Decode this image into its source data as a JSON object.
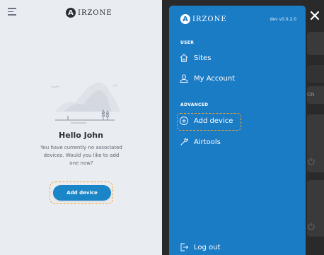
{
  "left": {
    "brand_mark": "A",
    "brand_word": "IRZONE",
    "greeting": "Hello John",
    "message": "You have currently no associated devices. Would you like to add one now?",
    "add_button": "Add device"
  },
  "drawer": {
    "brand_mark": "A",
    "brand_word": "IRZONE",
    "version": "dev v0.0.2.0",
    "sections": {
      "user": "USER",
      "advanced": "ADVANCED"
    },
    "items": {
      "sites": "Sites",
      "my_account": "My Account",
      "add_device": "Add device",
      "airtools": "Airtools",
      "logout": "Log out"
    }
  },
  "background": {
    "partial_label": "ON"
  },
  "colors": {
    "brand_blue": "#1b7cc6",
    "highlight_dashed": "#f0a42c",
    "left_background": "#e9edf2"
  },
  "icons": [
    "menu-icon",
    "home-icon",
    "user-icon",
    "plus-circle-icon",
    "wrench-icon",
    "logout-icon",
    "close-icon",
    "power-icon"
  ]
}
